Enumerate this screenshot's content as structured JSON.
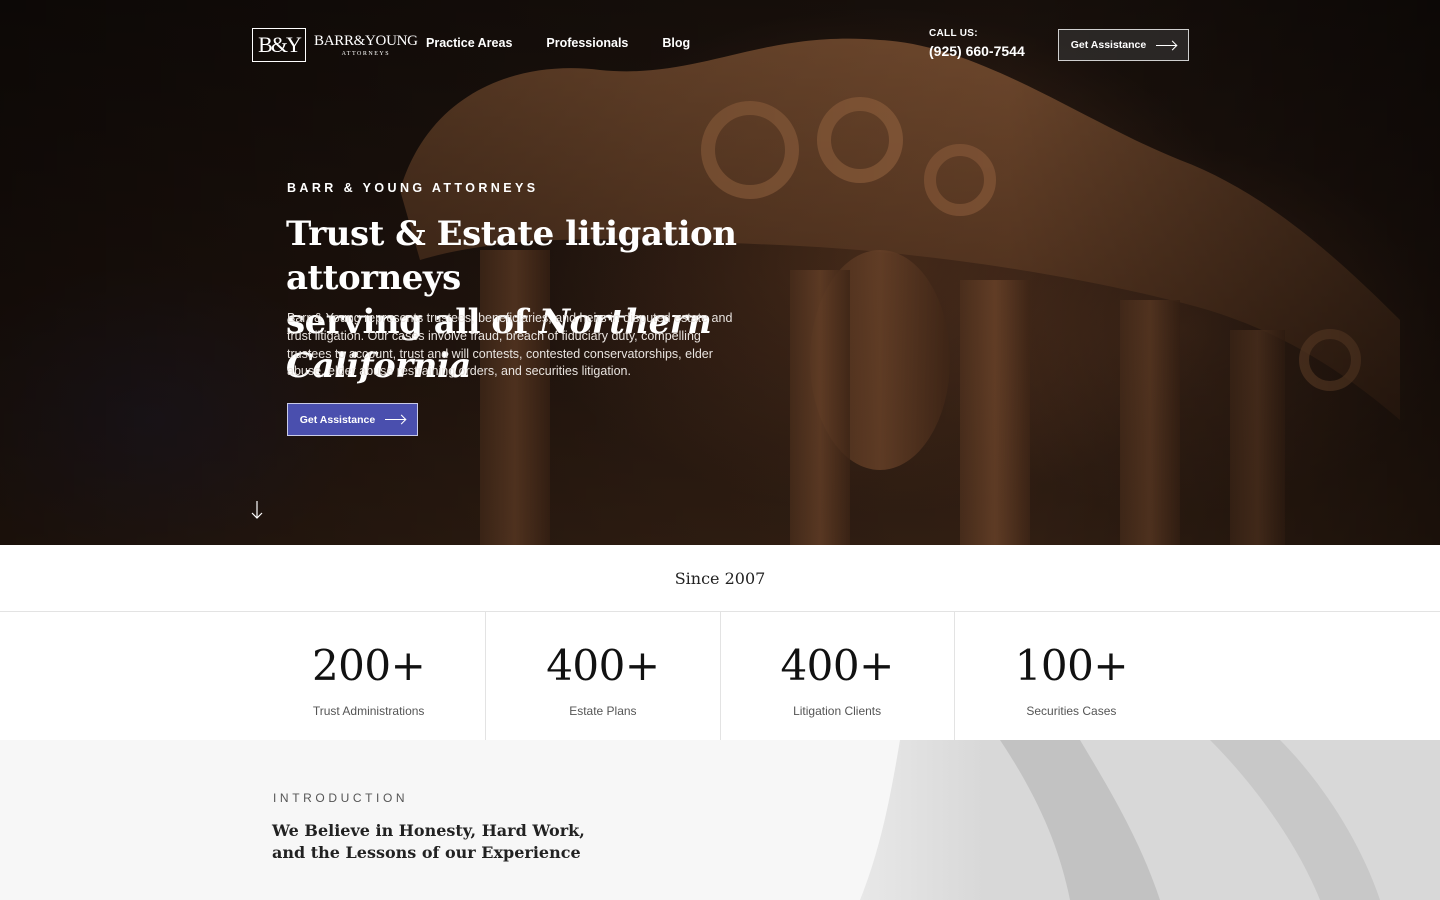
{
  "header": {
    "logo_mark": "B&Y",
    "logo_name": "BARR&YOUNG",
    "logo_sub": "ATTORNEYS",
    "nav": [
      {
        "label": "Practice Areas"
      },
      {
        "label": "Professionals"
      },
      {
        "label": "Blog"
      }
    ],
    "call_label": "CALL US:",
    "phone": "(925) 660-7544",
    "cta_label": "Get Assistance"
  },
  "hero": {
    "eyebrow": "BARR & YOUNG ATTORNEYS",
    "headline_line1": "Trust & Estate litigation attorneys",
    "headline_line2_prefix": "serving all of ",
    "headline_line2_em": "Northern California",
    "body": "Barr & Young represents trustees, beneficiaries, and heirs in disputed estate and trust litigation. Our cases involve fraud, breach of fiduciary duty, compelling trustees to account, trust and will contests, contested conservatorships, elder abuse, elder abuse restraining orders, and securities litigation.",
    "cta_label": "Get Assistance",
    "scroll_icon": "arrow-down-icon"
  },
  "since": "Since 2007",
  "stats": [
    {
      "value": "200+",
      "label": "Trust Administrations"
    },
    {
      "value": "400+",
      "label": "Estate Plans"
    },
    {
      "value": "400+",
      "label": "Litigation Clients"
    },
    {
      "value": "100+",
      "label": "Securities Cases"
    }
  ],
  "intro": {
    "label": "INTRODUCTION",
    "title": "We Believe in Honesty, Hard Work, and the Lessons of our Experience"
  },
  "colors": {
    "cta_primary": "#4a4fae",
    "hero_dark": "#1b120d",
    "wood": "#6b4228"
  }
}
